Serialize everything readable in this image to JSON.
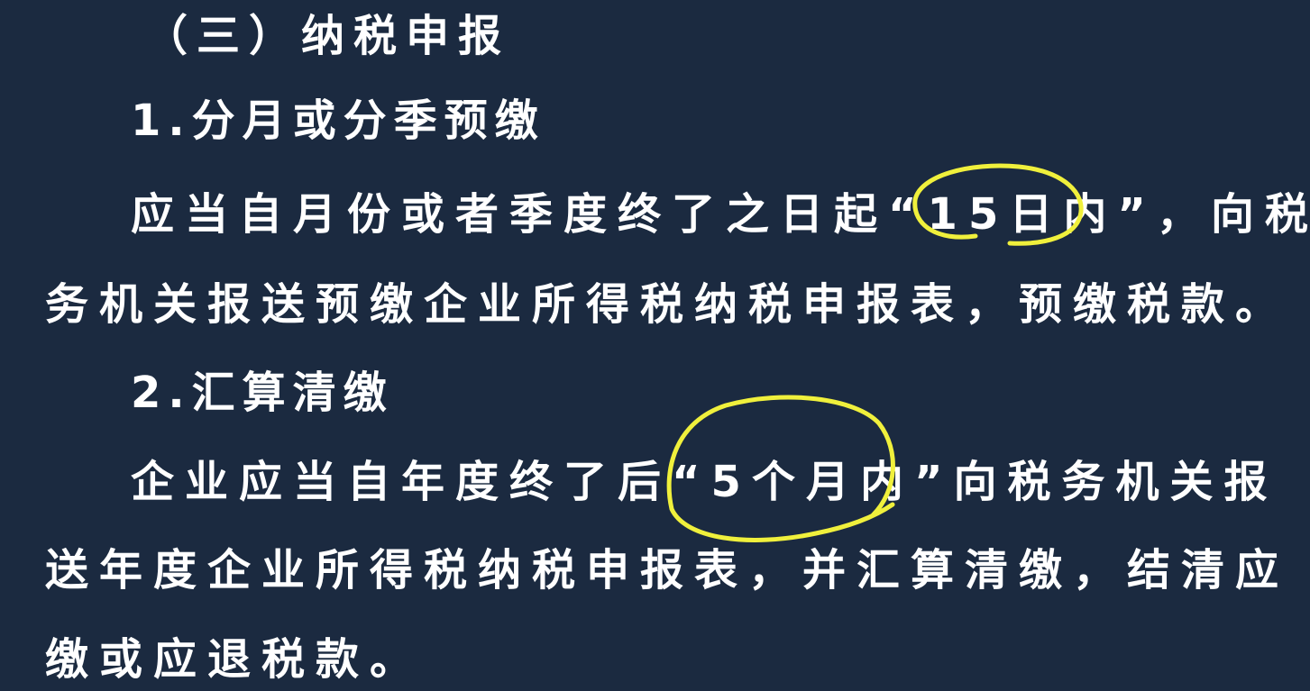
{
  "slide": {
    "section_heading": "（三）纳税申报",
    "subsections": [
      {
        "heading": "1.分月或分季预缴",
        "lines": [
          "应当自月份或者季度终了之日起“15日内”，向税",
          "务机关报送预缴企业所得税纳税申报表，预缴税款。"
        ]
      },
      {
        "heading": "2.汇算清缴",
        "lines": [
          "企业应当自年度终了后“5个月内”向税务机关报",
          "送年度企业所得税纳税申报表，并汇算清缴，结清应",
          "缴或应退税款。"
        ]
      }
    ]
  },
  "annotations": {
    "highlight_color": "#f0f03c",
    "circled_phrases": [
      "15日内",
      "5个月内"
    ]
  }
}
